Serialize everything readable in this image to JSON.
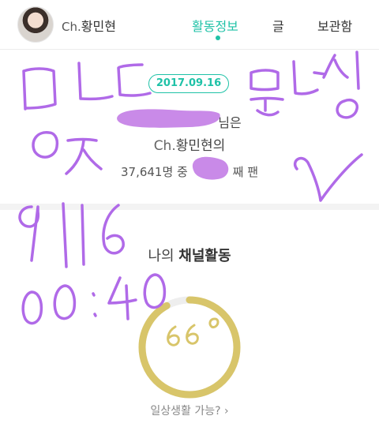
{
  "header": {
    "channel_prefix": "Ch.",
    "channel_name": "황민현",
    "tabs": [
      {
        "label": "활동정보",
        "active": true
      },
      {
        "label": "글",
        "active": false
      },
      {
        "label": "보관함",
        "active": false
      }
    ]
  },
  "fan_card": {
    "date": "2017.09.16",
    "line1_suffix": "님은",
    "channel_prefix": "Ch.",
    "channel_name": "황민현의",
    "count_prefix": "37,641명 중",
    "count_suffix": "째 팬"
  },
  "activity": {
    "title_prefix": "나의",
    "title_bold": "채널활동",
    "gauge_label": "일상생활 가능? ›",
    "gauge_fraction": 0.92,
    "gauge_color": "#d8c56a"
  },
  "handwriting": {
    "color": "#b06ae8",
    "texts": [
      "ㅁㄴㄷ",
      "ㅇㅈ",
      "9/16",
      "00:40",
      "뭐냐잇",
      "66°"
    ]
  },
  "colors": {
    "accent": "#1fc2a7",
    "redaction": "#c98ae8"
  }
}
